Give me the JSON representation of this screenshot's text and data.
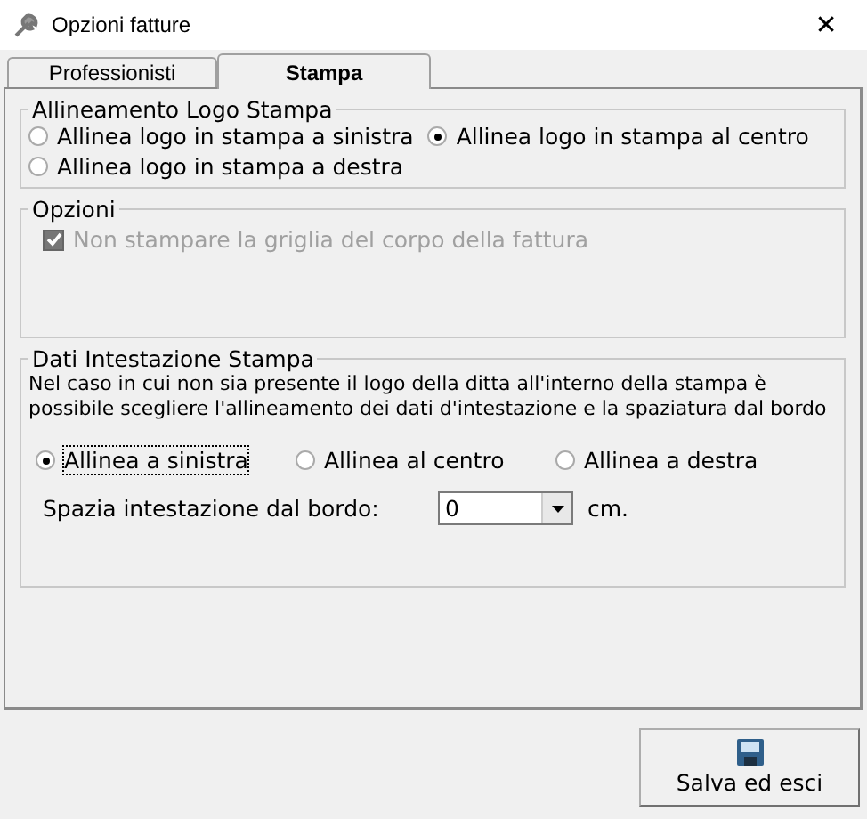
{
  "window": {
    "title": "Opzioni fatture",
    "close": "✕"
  },
  "tabs": [
    {
      "label": "Professionisti",
      "selected": false
    },
    {
      "label": "Stampa",
      "selected": true
    }
  ],
  "logo_group": {
    "title": "Allineamento Logo Stampa",
    "options": [
      {
        "label": "Allinea logo in stampa a sinistra",
        "selected": false
      },
      {
        "label": "Allinea logo in stampa al centro",
        "selected": true
      },
      {
        "label": "Allinea logo in stampa a destra",
        "selected": false
      }
    ]
  },
  "options_group": {
    "title": "Opzioni",
    "checkboxes": [
      {
        "label": "Non stampare la griglia del corpo della fattura",
        "checked": true,
        "disabled": true
      }
    ]
  },
  "header_group": {
    "title": "Dati Intestazione Stampa",
    "description": "Nel caso in cui non sia presente il logo della ditta all'interno della stampa è possibile scegliere l'allineamento dei dati d'intestazione e la spaziatura dal bordo",
    "options": [
      {
        "label": "Allinea a sinistra",
        "selected": true,
        "focused": true
      },
      {
        "label": "Allinea al centro",
        "selected": false,
        "focused": false
      },
      {
        "label": "Allinea a destra",
        "selected": false,
        "focused": false
      }
    ],
    "spacing": {
      "label": "Spazia intestazione dal bordo:",
      "value": "0",
      "unit": "cm."
    }
  },
  "buttons": [
    {
      "label": "Salva ed esci"
    }
  ]
}
